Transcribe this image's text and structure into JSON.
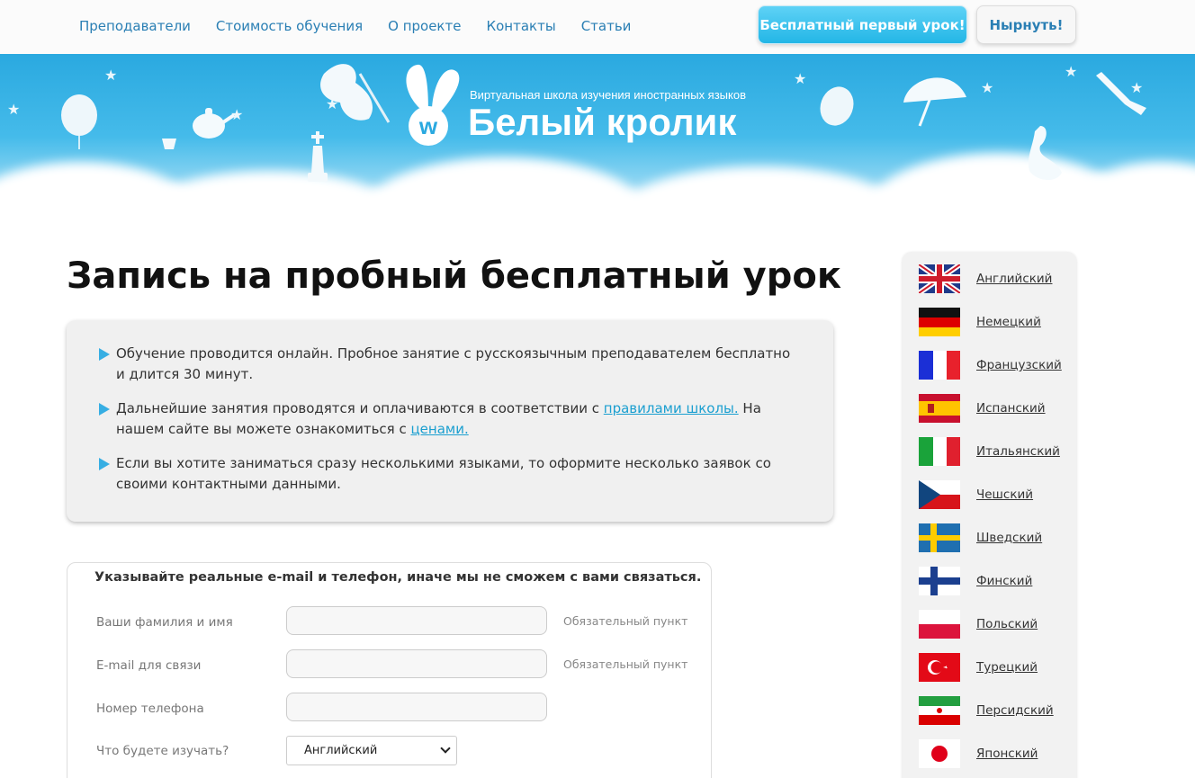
{
  "nav": {
    "items": [
      "Преподаватели",
      "Стоимость обучения",
      "О проекте",
      "Контакты",
      "Статьи"
    ],
    "free_lesson_button": "Бесплатный первый урок!",
    "dive_button": "Нырнуть!"
  },
  "banner": {
    "tagline": "Виртуальная школа изучения иностранных языков",
    "brand": "Белый кролик",
    "logo_letter": "w"
  },
  "main": {
    "title": "Запись на пробный бесплатный урок",
    "info": {
      "item1": "Обучение проводится онлайн. Пробное занятие с русскоязычным преподавателем бесплатно и длится 30 минут.",
      "item2_before": "Дальнейшие занятия проводятся и оплачиваются в соответствии с ",
      "item2_link1": "правилами школы.",
      "item2_middle": " На нашем сайте вы можете ознакомиться с ",
      "item2_link2": "ценами.",
      "item3": "Если вы хотите заниматься сразу несколькими языками, то оформите несколько заявок со своими контактными данными."
    },
    "form": {
      "warning": "Указывайте реальные e-mail и телефон, иначе мы не сможем с вами связаться.",
      "name_label": "Ваши фамилия и имя",
      "email_label": "E-mail для связи",
      "phone_label": "Номер телефона",
      "study_label": "Что будете изучать?",
      "required": "Обязательный пункт",
      "name_value": "",
      "email_value": "",
      "phone_value": "",
      "study_selected": "Английский"
    }
  },
  "sidebar": {
    "languages": [
      {
        "label": "Английский",
        "flag": "uk-flag-icon"
      },
      {
        "label": "Немецкий",
        "flag": "germany-flag-icon"
      },
      {
        "label": "Французский",
        "flag": "france-flag-icon"
      },
      {
        "label": "Испанский",
        "flag": "spain-flag-icon"
      },
      {
        "label": "Итальянский",
        "flag": "italy-flag-icon"
      },
      {
        "label": "Чешский",
        "flag": "czech-flag-icon"
      },
      {
        "label": "Шведский",
        "flag": "sweden-flag-icon"
      },
      {
        "label": "Финский",
        "flag": "finland-flag-icon"
      },
      {
        "label": "Польский",
        "flag": "poland-flag-icon"
      },
      {
        "label": "Турецкий",
        "flag": "turkey-flag-icon"
      },
      {
        "label": "Персидский",
        "flag": "iran-flag-icon"
      },
      {
        "label": "Японский",
        "flag": "japan-flag-icon"
      }
    ]
  },
  "colors": {
    "accent": "#2a7fb4",
    "sky": "#2aa9e0",
    "button_blue": "#23b6e6"
  }
}
